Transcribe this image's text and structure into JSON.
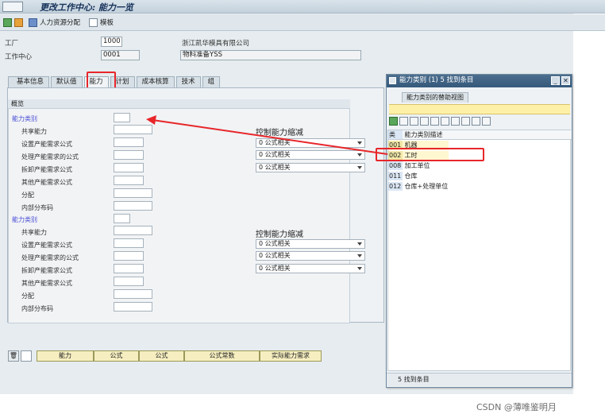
{
  "window": {
    "title": "更改工作中心: 能力一览"
  },
  "toolbar": {
    "hr_label": "人力资源分配",
    "template_label": "模板"
  },
  "header": {
    "plant_label": "工厂",
    "plant_value": "1000",
    "plant_desc": "浙江凯华模具有限公司",
    "wc_label": "工作中心",
    "wc_value": "0001",
    "wc_desc": "物料准备YSS"
  },
  "tabs": [
    {
      "label": "基本信息"
    },
    {
      "label": "默认值"
    },
    {
      "label": "能力"
    },
    {
      "label": "计划"
    },
    {
      "label": "成本核算"
    },
    {
      "label": "技术"
    },
    {
      "label": "组"
    }
  ],
  "overview": {
    "title": "概览",
    "section_label": "能力类别",
    "row_labels": [
      "共享能力",
      "设置产能需求公式",
      "处理产能需求的公式",
      "拆卸产能需求公式",
      "其他产能需求公式",
      "分配",
      "内部分布码"
    ],
    "control_header": "控制能力缩减",
    "select_value": "0 公式相关"
  },
  "bottom_buttons": [
    "能力",
    "公式",
    "公式",
    "公式常数",
    "实际能力需求"
  ],
  "popup": {
    "title": "能力类别 (1)    5 找到条目",
    "tab_label": "能力类别的替助视图",
    "col_code": "类",
    "col_desc": "能力类别描述",
    "items": [
      {
        "code": "001",
        "desc": "机器"
      },
      {
        "code": "002",
        "desc": "工时"
      },
      {
        "code": "008",
        "desc": "加工单位"
      },
      {
        "code": "011",
        "desc": "仓库"
      },
      {
        "code": "012",
        "desc": "仓库+处理单位"
      }
    ],
    "status": "5 找到条目"
  },
  "watermark": "CSDN @薄唯鉴明月",
  "colors": {
    "highlight": "#e8262a",
    "title_blue": "#35597b",
    "row_blue": "#4c4fd6"
  }
}
